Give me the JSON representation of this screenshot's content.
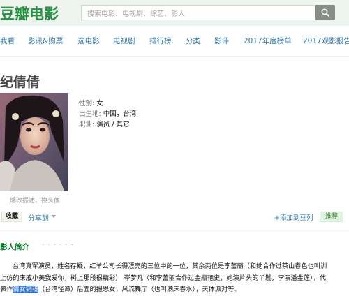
{
  "header": {
    "logo": "豆瓣电影",
    "search_placeholder": "搜索电影、电视剧、综艺、影人"
  },
  "nav": [
    "我看",
    "影讯&购票",
    "选电影",
    "电视剧",
    "排行榜",
    "分类",
    "影评",
    "2017年度榜单",
    "2017观影报告"
  ],
  "person": {
    "name": "纪倩倩",
    "gender_label": "性别:",
    "gender": "女",
    "birthplace_label": "出生地:",
    "birthplace": "中国，台湾",
    "occupation_label": "职业:",
    "occupation": "演员 / 其它",
    "photo_caption": "爆改振述、换头像"
  },
  "actions": {
    "collect": "收藏",
    "share": "分享到",
    "add_list": "+添加到豆列",
    "recommend": "推荐"
  },
  "bio": {
    "title": "影人简介",
    "dots": "· · · · · ·",
    "line1": "台湾真军演员，姓名存疑，红羊公司长得漂亮的三位中的一位，其余两位是李蕾丽（和她合作过茶山春色也叫训",
    "line2": "上仿的床戚小美我爱你，树上那段很精彩） 岑梦凡（和李蕾丽合作过金瓶艳史，她演片头的丫鬟，李演潘金莲），代",
    "line3_pre": "表作",
    "line3_highlight": "倩女销魂",
    "line3_post": "（台湾怪谭）后面的报恩女，风流舞厅（也叫满床春水），天体派对等。"
  },
  "colors": {
    "logo": "#2a8f45",
    "link": "#3377aa",
    "topbar_bg": "#edf4ed",
    "section_title": "#007722",
    "highlight": "#3a78d6"
  }
}
